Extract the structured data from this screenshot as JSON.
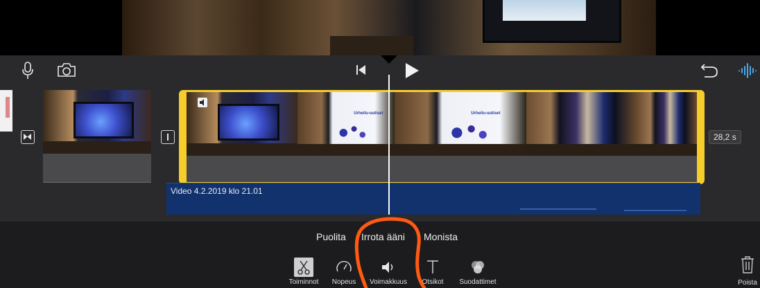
{
  "timeline": {
    "duration_label": "28,2 s",
    "clip_b_thumb_text": "Urheilu-uutiset",
    "audio_clip_label": "Video 4.2.2019 klo 21.01"
  },
  "actions": {
    "split": "Puolita",
    "detach_audio": "Irrota ääni",
    "duplicate": "Monista"
  },
  "tools": [
    {
      "label": "Toiminnot",
      "icon": "scissors-icon"
    },
    {
      "label": "Nopeus",
      "icon": "speedometer-icon"
    },
    {
      "label": "Voimakkuus",
      "icon": "speaker-icon"
    },
    {
      "label": "Otsikot",
      "icon": "title-text-icon"
    },
    {
      "label": "Suodattimet",
      "icon": "filters-icon"
    }
  ],
  "trash": {
    "label": "Poista",
    "icon": "trash-icon"
  },
  "colors": {
    "clip_selection": "#f7cd2c",
    "audio_track": "#12326e",
    "waveform_accent": "#4db6ff",
    "annotation": "#ff5a12"
  }
}
